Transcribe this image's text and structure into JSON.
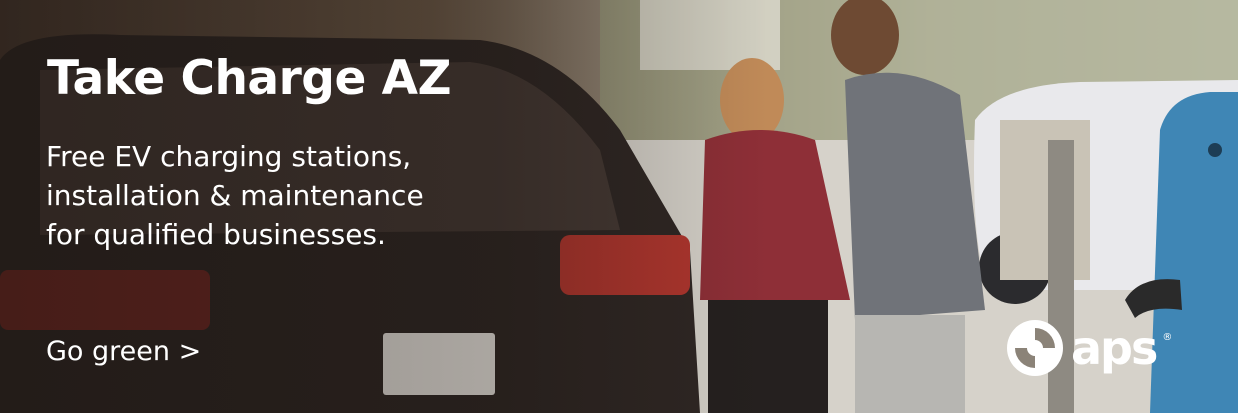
{
  "ad": {
    "headline": "Take Charge AZ",
    "subline_lines": [
      "Free EV charging stations,",
      "installation & maintenance",
      "for qualified businesses."
    ],
    "cta_label": "Go green >"
  },
  "brand": {
    "logo_text": "aps",
    "logo_mark": "registered-mark",
    "registered_symbol": "®",
    "icon": "aps-swirl-icon"
  },
  "colors": {
    "text": "#ffffff",
    "charger_blue": "#3f86b5"
  }
}
